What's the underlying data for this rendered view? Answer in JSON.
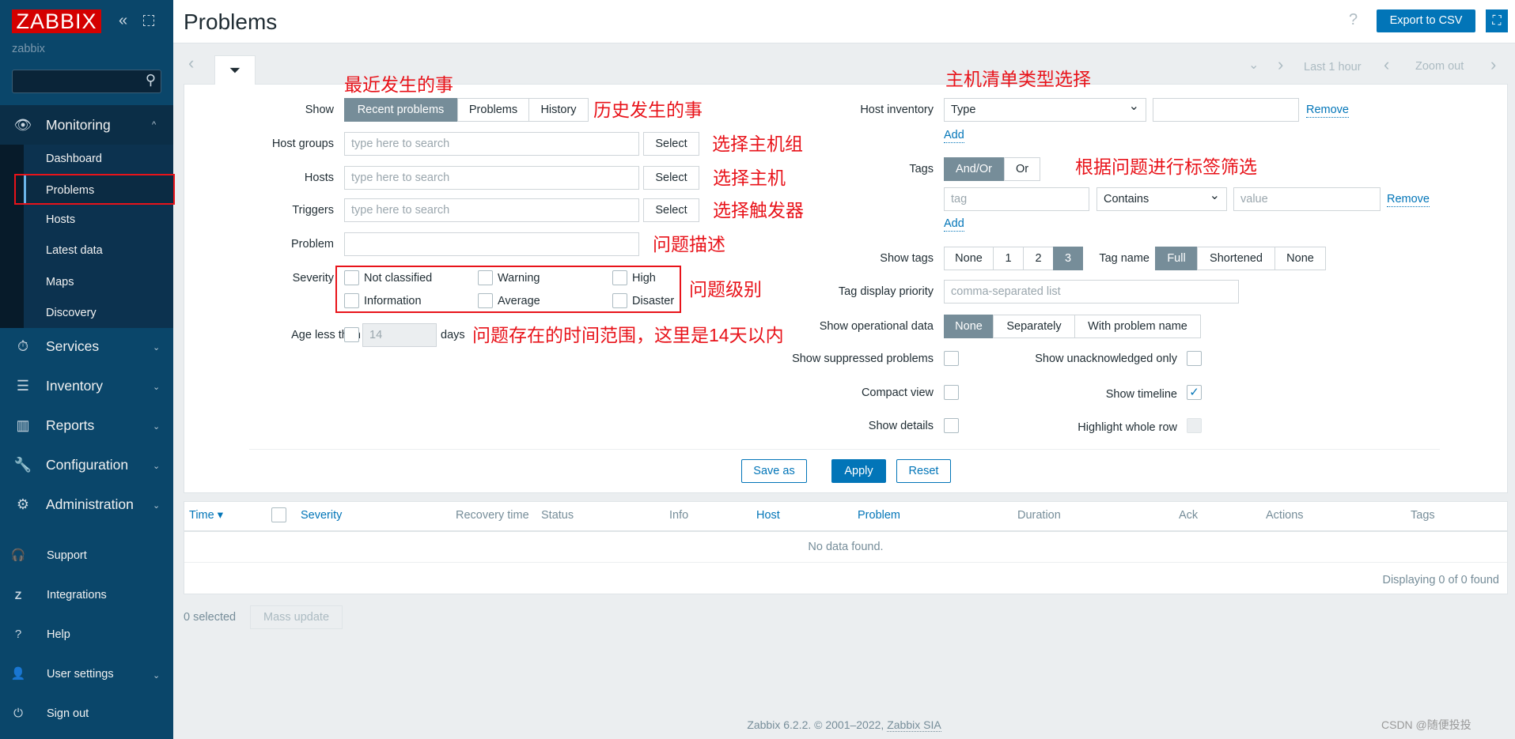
{
  "sidebar": {
    "logo": "ZABBIX",
    "server": "zabbix",
    "collapse_icon": "double-chevron-left",
    "kiosk_icon": "expand-icon",
    "menu": [
      {
        "label": "Monitoring",
        "icon": "eye"
      },
      {
        "label": "Services",
        "icon": "stopwatch"
      },
      {
        "label": "Inventory",
        "icon": "list"
      },
      {
        "label": "Reports",
        "icon": "bar-chart"
      },
      {
        "label": "Configuration",
        "icon": "wrench"
      },
      {
        "label": "Administration",
        "icon": "gear"
      }
    ],
    "submenu": [
      "Dashboard",
      "Problems",
      "Hosts",
      "Latest data",
      "Maps",
      "Discovery"
    ],
    "active": "Problems",
    "bottom": [
      {
        "label": "Support",
        "icon": "headset"
      },
      {
        "label": "Integrations",
        "icon": "z-box"
      },
      {
        "label": "Help",
        "icon": "question"
      },
      {
        "label": "User settings",
        "icon": "user"
      },
      {
        "label": "Sign out",
        "icon": "power"
      }
    ]
  },
  "header": {
    "title": "Problems",
    "help": "?",
    "export": "Export to CSV"
  },
  "timenav": {
    "range": "Last 1 hour",
    "zoom_out": "Zoom out"
  },
  "filter": {
    "show_label": "Show",
    "show_options": [
      "Recent problems",
      "Problems",
      "History"
    ],
    "show_selected": "Recent problems",
    "host_groups": {
      "label": "Host groups",
      "placeholder": "type here to search",
      "button": "Select"
    },
    "hosts": {
      "label": "Hosts",
      "placeholder": "type here to search",
      "button": "Select"
    },
    "triggers": {
      "label": "Triggers",
      "placeholder": "type here to search",
      "button": "Select"
    },
    "problem": {
      "label": "Problem",
      "value": ""
    },
    "severity": {
      "label": "Severity",
      "options": [
        "Not classified",
        "Warning",
        "High",
        "Information",
        "Average",
        "Disaster"
      ]
    },
    "age": {
      "label": "Age less than",
      "value": "14",
      "unit": "days"
    },
    "host_inventory": {
      "label": "Host inventory",
      "field": "Type",
      "value": "",
      "remove": "Remove",
      "add": "Add"
    },
    "tags": {
      "label": "Tags",
      "options": [
        "And/Or",
        "Or"
      ],
      "selected": "And/Or",
      "tag_placeholder": "tag",
      "operator": "Contains",
      "value_placeholder": "value",
      "remove": "Remove",
      "add": "Add"
    },
    "show_tags": {
      "label": "Show tags",
      "options": [
        "None",
        "1",
        "2",
        "3"
      ],
      "selected": "3"
    },
    "tag_name": {
      "label": "Tag name",
      "options": [
        "Full",
        "Shortened",
        "None"
      ],
      "selected": "Full"
    },
    "tag_priority": {
      "label": "Tag display priority",
      "placeholder": "comma-separated list"
    },
    "op_data": {
      "label": "Show operational data",
      "options": [
        "None",
        "Separately",
        "With problem name"
      ],
      "selected": "None"
    },
    "checks": {
      "suppressed": "Show suppressed problems",
      "unack": "Show unacknowledged only",
      "compact": "Compact view",
      "timeline": "Show timeline",
      "details": "Show details",
      "highlight": "Highlight whole row"
    },
    "checked": {
      "timeline": true
    },
    "save_as": "Save as",
    "apply": "Apply",
    "reset": "Reset"
  },
  "table": {
    "columns": [
      "Time ▾",
      "Severity",
      "Recovery time",
      "Status",
      "Info",
      "Host",
      "Problem",
      "Duration",
      "Ack",
      "Actions",
      "Tags"
    ],
    "empty": "No data found.",
    "summary": "Displaying 0 of 0 found"
  },
  "bulk": {
    "selected": "0 selected",
    "mass_update": "Mass update"
  },
  "footer": {
    "text": "Zabbix 6.2.2. © 2001–2022, ",
    "link": "Zabbix SIA"
  },
  "watermark": "CSDN @随便投投",
  "annotations": [
    "最近发生的事",
    "历史发生的事",
    "选择主机组",
    "选择主机",
    "选择触发器",
    "问题描述",
    "问题级别",
    "问题存在的时间范围，这里是14天以内",
    "主机清单类型选择",
    "根据问题进行标签筛选"
  ],
  "colors": {
    "sidebar": "#0a466a",
    "accent": "#0275b8",
    "annotation": "#e8131a",
    "segment_selected": "#768d99"
  }
}
